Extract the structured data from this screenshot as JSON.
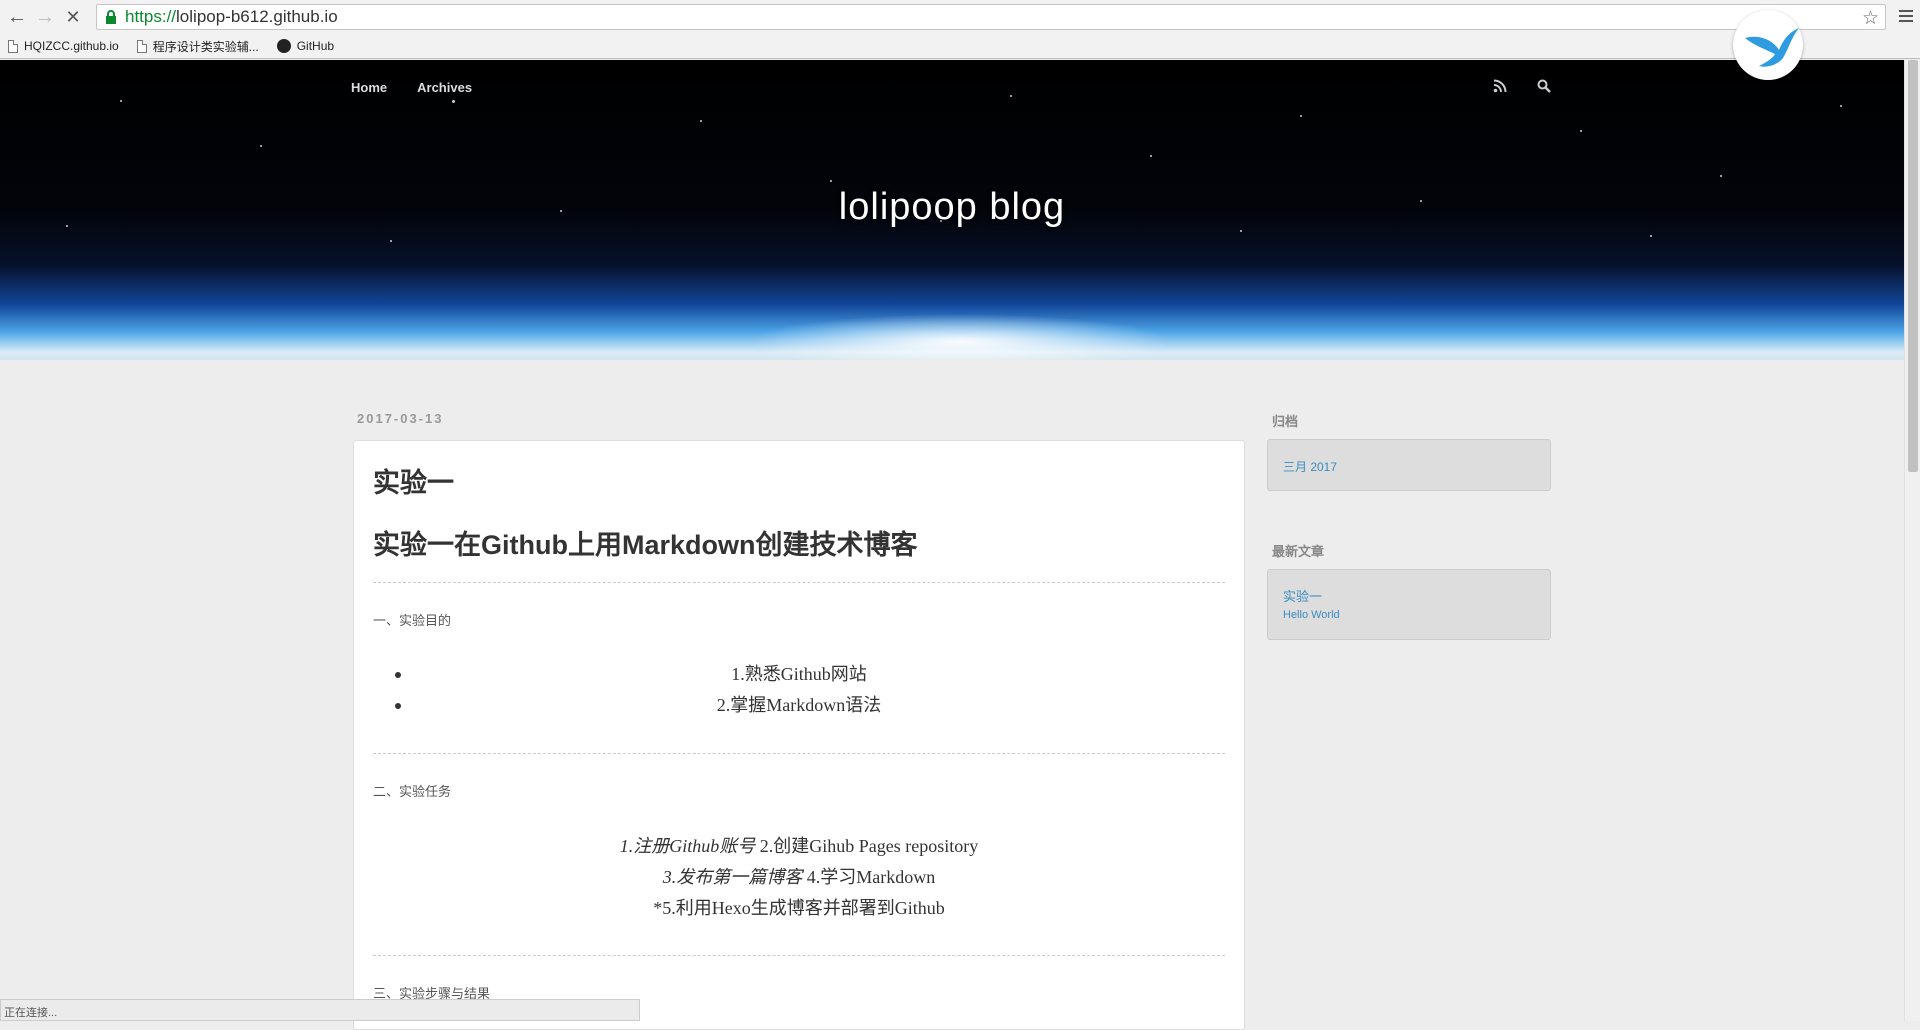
{
  "browser": {
    "url_protocol": "https://",
    "url_rest": "lolipop-b612.github.io",
    "bookmarks": [
      {
        "label": "HQIZCC.github.io",
        "icon": "page-icon"
      },
      {
        "label": "程序设计类实验辅...",
        "icon": "page-icon"
      },
      {
        "label": "GitHub",
        "icon": "github-icon"
      }
    ],
    "status_text": "正在连接..."
  },
  "site": {
    "nav": [
      "Home",
      "Archives"
    ],
    "title": "lolipoop blog"
  },
  "post": {
    "date": "2017-03-13",
    "title": "实验一",
    "heading": "实验一在Github上用Markdown创建技术博客",
    "section1": "一、实验目的",
    "goals": [
      "1.熟悉Github网站",
      "2.掌握Markdown语法"
    ],
    "section2": "二、实验任务",
    "tasks": [
      {
        "em": "1.注册Github账号",
        "rest": " 2.创建Gihub Pages repository"
      },
      {
        "em": "3.发布第一篇博客",
        "rest": " 4.学习Markdown"
      },
      {
        "em": "",
        "rest": "*5.利用Hexo生成博客并部署到Github"
      }
    ],
    "section3": "三、实验步骤与结果"
  },
  "sidebar": {
    "archive_title": "归档",
    "archive_items": [
      "三月 2017"
    ],
    "recent_title": "最新文章",
    "recent_items": [
      "实验一",
      "Hello World"
    ]
  }
}
